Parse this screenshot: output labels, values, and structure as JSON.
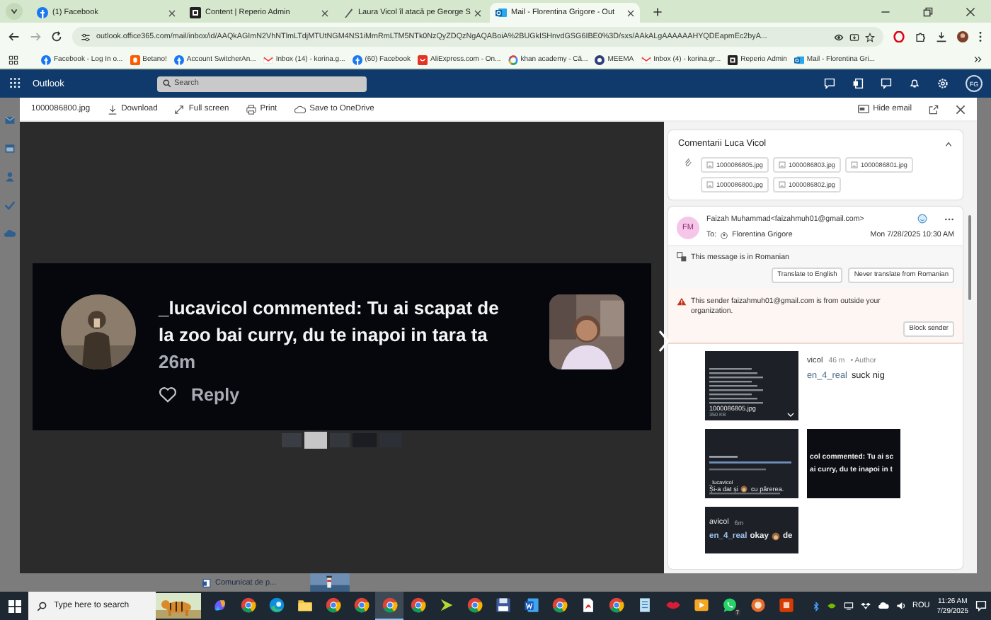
{
  "browser": {
    "tabs": [
      {
        "title": "(1) Facebook",
        "kind": "facebook",
        "selected": false
      },
      {
        "title": "Content | Reperio Admin",
        "kind": "reperio",
        "selected": false
      },
      {
        "title": "Laura Vicol îl atacă pe George S",
        "kind": "news",
        "selected": false
      },
      {
        "title": "Mail - Florentina Grigore - Out",
        "kind": "outlook",
        "selected": true
      }
    ],
    "url": "outlook.office365.com/mail/inbox/id/AAQkAGImN2VhNTlmLTdjMTUtNGM4NS1iMmRmLTM5NTk0NzQyZDQzNgAQABoiA%2BUGkISHnvdGSG6IBE0%3D/sxs/AAkALgAAAAAAHYQDEapmEc2byA...",
    "bookmarks": [
      {
        "label": "Facebook - Log In o...",
        "kind": "facebook"
      },
      {
        "label": "Betano!",
        "kind": "betano"
      },
      {
        "label": "Account SwitcherAn...",
        "kind": "facebook"
      },
      {
        "label": "Inbox (14) - korina.g...",
        "kind": "gmail"
      },
      {
        "label": "(60) Facebook",
        "kind": "facebook"
      },
      {
        "label": "AliExpress.com - On...",
        "kind": "aliexpress"
      },
      {
        "label": "khan academy - Că...",
        "kind": "google"
      },
      {
        "label": "MEEMA",
        "kind": "meema"
      },
      {
        "label": "Inbox (4) - korina.gr...",
        "kind": "gmail"
      },
      {
        "label": "Reperio Admin",
        "kind": "reperio"
      },
      {
        "label": "Mail - Florentina Gri...",
        "kind": "outlook"
      }
    ]
  },
  "outlook": {
    "app_name": "Outlook",
    "search": {
      "placeholder": "Search"
    },
    "account_initials": "FG"
  },
  "viewer": {
    "file_name": "1000086800.jpg",
    "actions": [
      {
        "label": "Download",
        "kind": "download"
      },
      {
        "label": "Full screen",
        "kind": "fullscreen"
      },
      {
        "label": "Print",
        "kind": "print"
      },
      {
        "label": "Save to OneDrive",
        "kind": "cloud"
      }
    ],
    "hide_email": "Hide email",
    "image": {
      "comment": "_lucavicol commented: Tu ai scapat de la zoo bai curry, du te inapoi in tara ta",
      "time": "26m",
      "reply": "Reply"
    }
  },
  "reading_pane": {
    "subject": "Comentarii Luca Vicol",
    "attachments": [
      "1000086805.jpg",
      "1000086803.jpg",
      "1000086801.jpg",
      "1000086800.jpg",
      "1000086802.jpg"
    ],
    "message": {
      "initials": "FM",
      "from": "Faizah Muhammad<faizahmuh01@gmail.com>",
      "to_label": "To:",
      "to": "Florentina Grigore",
      "date": "Mon 7/28/2025 10:30 AM",
      "translation": {
        "text": "This message is in Romanian",
        "buttons": [
          "Translate to English",
          "Never translate from Romanian"
        ]
      },
      "warning": {
        "text": "This sender faizahmuh01@gmail.com is from outside your organization.",
        "button": "Block sender"
      },
      "body_images": {
        "first": {
          "file_name": "1000086805.jpg",
          "size": "350 KB"
        },
        "crop_top": {
          "user": "vicol",
          "time": "46 m",
          "tag": "• Author",
          "mention": "en_4_real",
          "text": "suck nig"
        },
        "second": {
          "user": "_lucavicol",
          "text_before": "Și-a dat și",
          "text_after": "cu părerea."
        },
        "crop_middle": {
          "lines": [
            "col commented: Tu ai sc",
            "ai curry, du te inapoi in t"
          ]
        },
        "third": {
          "user": "avicol",
          "time": "6m",
          "mention": "en_4_real",
          "text": "okay",
          "after": "de"
        }
      }
    }
  },
  "background": {
    "item": "Comunicat de p..."
  },
  "taskbar": {
    "search": {
      "placeholder": "Type here to search"
    },
    "apps": [
      {
        "kind": "copilot",
        "selected": false
      },
      {
        "kind": "chrome",
        "selected": false
      },
      {
        "kind": "edge",
        "selected": false
      },
      {
        "kind": "folder",
        "selected": false
      },
      {
        "kind": "chrome",
        "selected": false
      },
      {
        "kind": "chrome",
        "selected": false
      },
      {
        "kind": "chrome",
        "selected": true
      },
      {
        "kind": "chrome",
        "selected": false
      },
      {
        "kind": "arrow",
        "selected": false
      },
      {
        "kind": "chrome",
        "selected": false
      },
      {
        "kind": "save",
        "selected": false
      },
      {
        "kind": "word",
        "selected": false
      },
      {
        "kind": "chrome",
        "selected": false
      },
      {
        "kind": "pdf",
        "selected": false
      },
      {
        "kind": "chrome",
        "selected": false
      },
      {
        "kind": "notes",
        "selected": false
      },
      {
        "kind": "lips",
        "selected": false
      },
      {
        "kind": "video",
        "selected": false
      },
      {
        "kind": "whatsapp",
        "badge": "7",
        "selected": false
      },
      {
        "kind": "ring",
        "selected": false
      },
      {
        "kind": "office",
        "selected": false
      }
    ],
    "language": "ROU",
    "time": "11:26 AM",
    "date": "7/29/2025"
  }
}
